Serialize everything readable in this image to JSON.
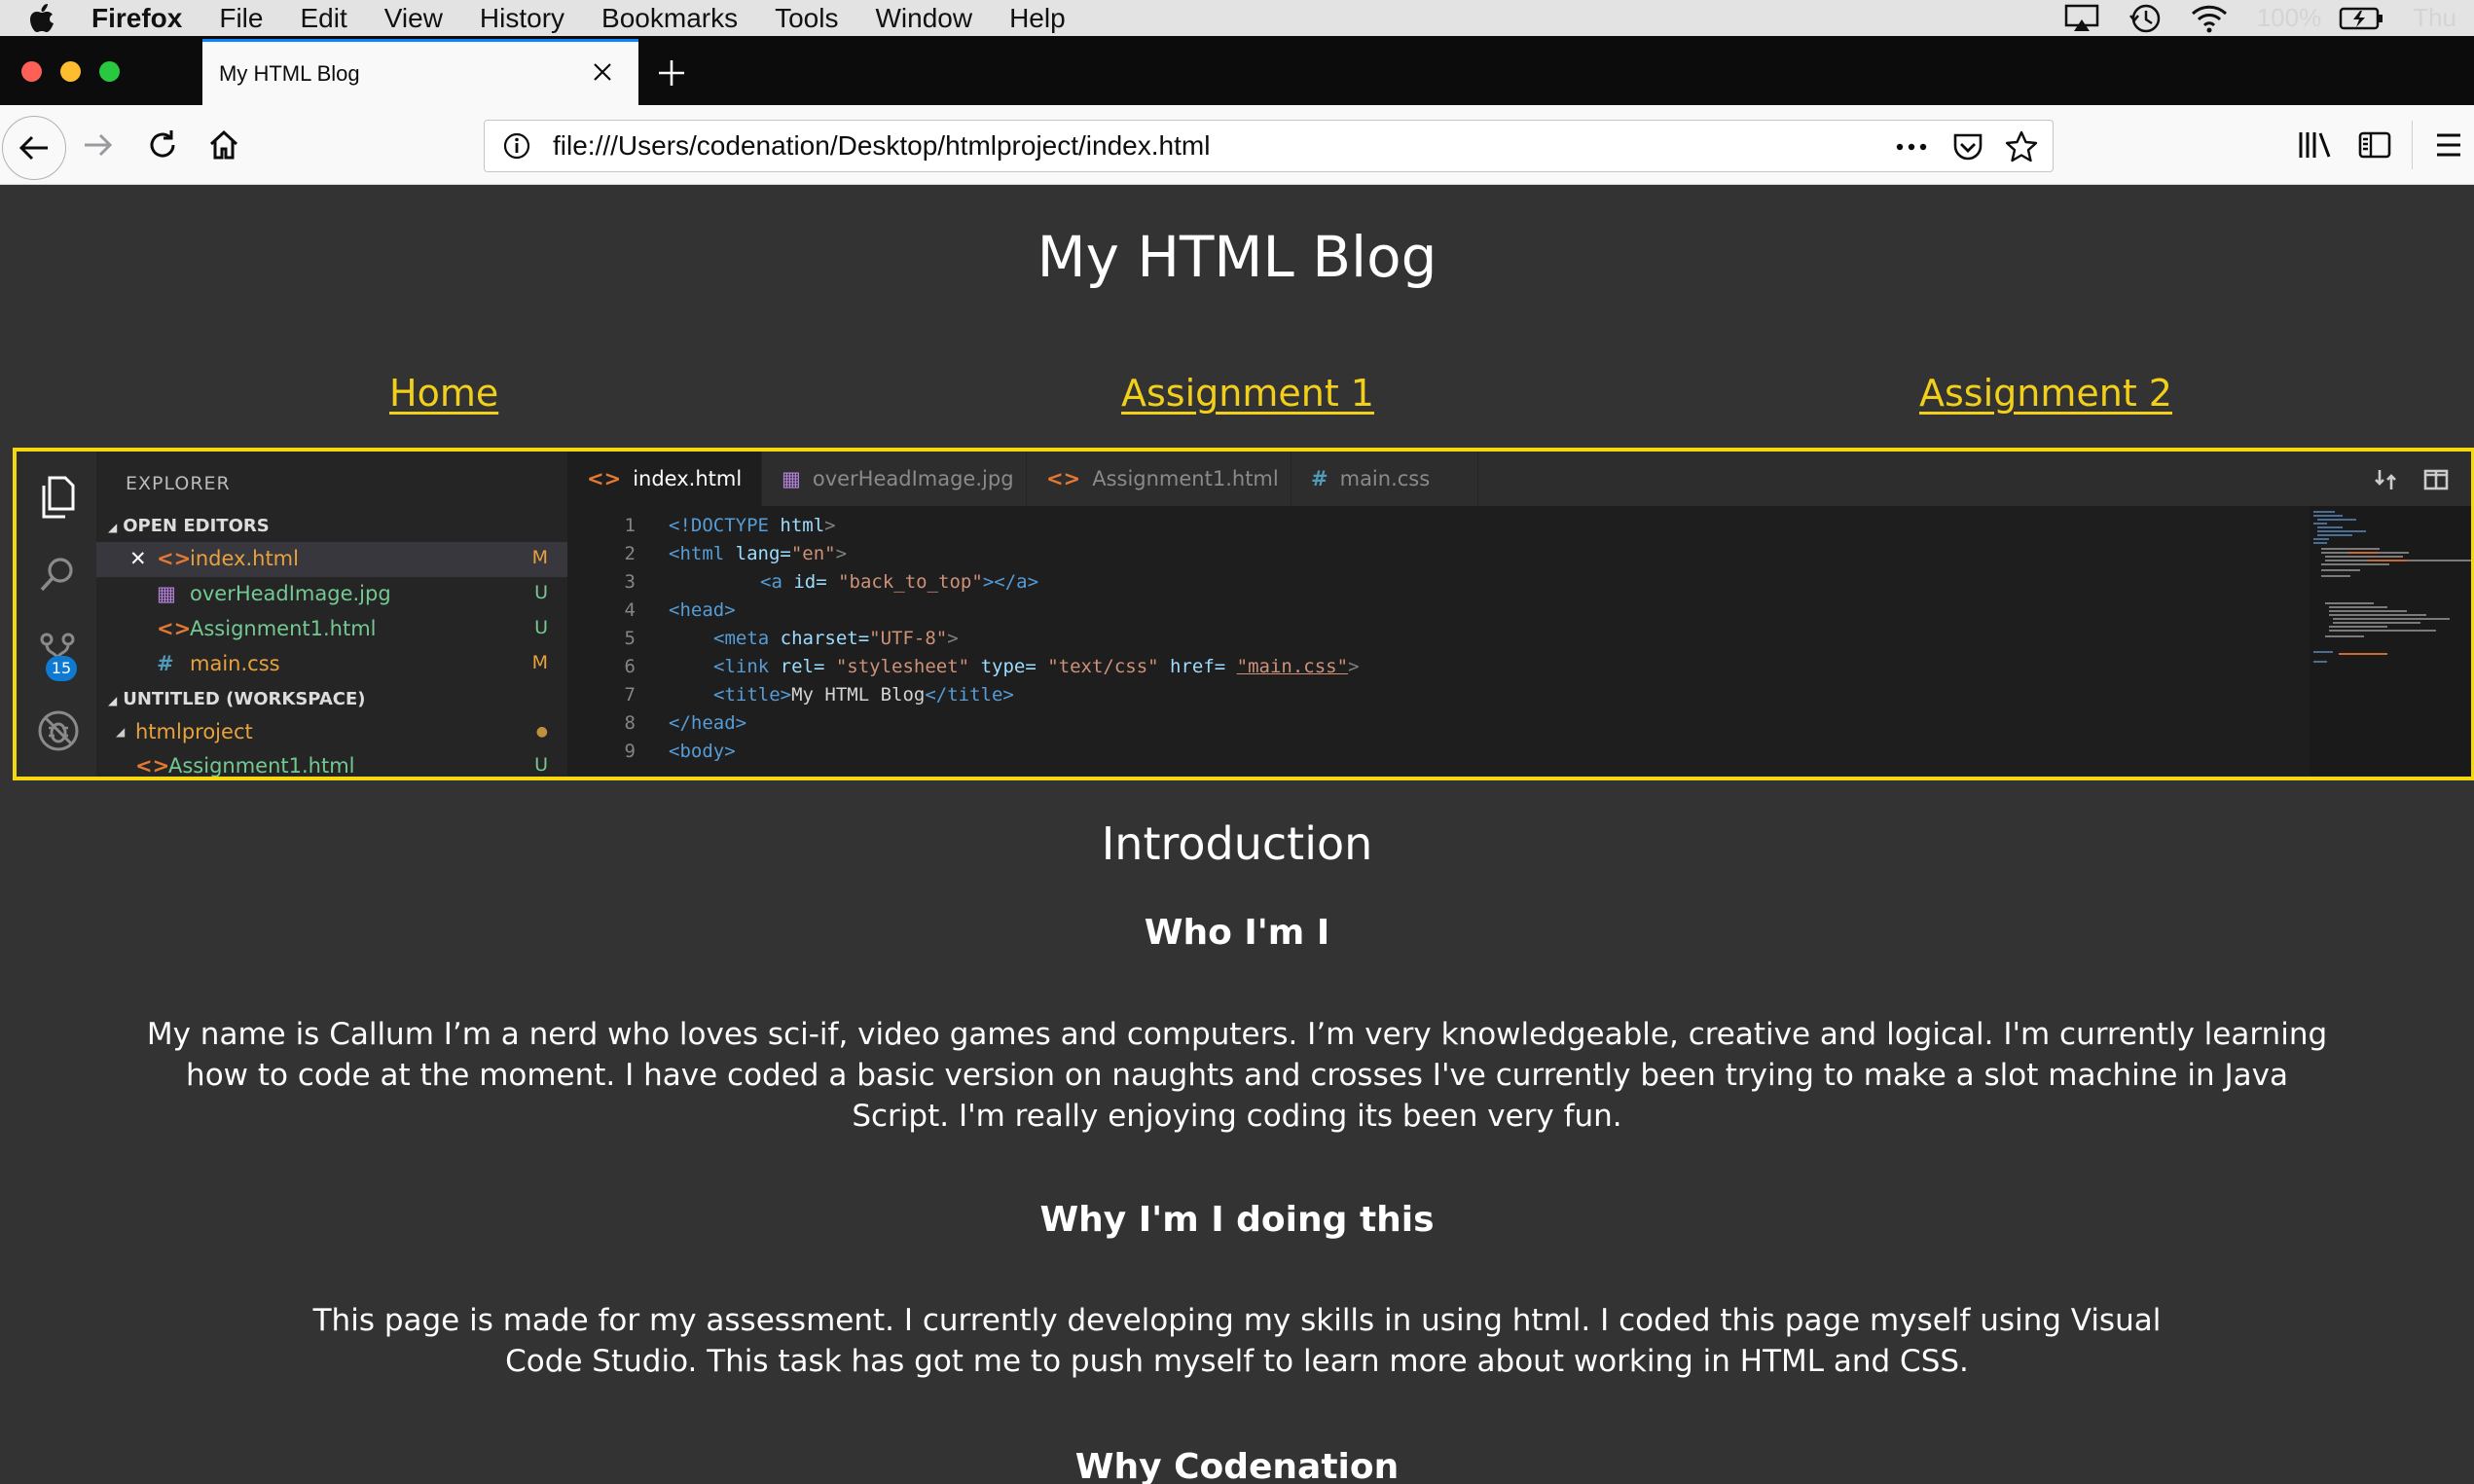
{
  "menubar": {
    "app_name": "Firefox",
    "items": [
      "File",
      "Edit",
      "View",
      "History",
      "Bookmarks",
      "Tools",
      "Window",
      "Help"
    ],
    "battery": "100%",
    "clock": "Thu",
    "icons": [
      "apple-icon",
      "airplay-icon",
      "time-machine-icon",
      "wifi-icon",
      "battery-icon"
    ]
  },
  "browser": {
    "tab_title": "My HTML Blog",
    "url": "file:///Users/codenation/Desktop/htmlproject/index.html",
    "accent": "#0a84ff"
  },
  "page": {
    "title": "My HTML Blog",
    "nav": {
      "home": "Home",
      "assignment1": "Assignment 1",
      "assignment2": "Assignment 2"
    },
    "link_color": "#f2cf1b",
    "background": "#333333",
    "intro_heading": "Introduction",
    "sections": [
      {
        "heading": "Who I'm I",
        "paragraph": "My name is Callum I’m a nerd who loves sci-if, video games and computers. I’m very knowledgeable, creative and logical. I'm currently learning how to code at the moment. I have coded a basic version on naughts and crosses I've currently been trying to make a slot machine in Java Script. I'm really enjoying coding its been very fun."
      },
      {
        "heading": "Why I'm I doing this",
        "paragraph": "This page is made for my assessment. I currently developing my skills in using html. I coded this page myself using Visual Code Studio. This task has got me to push myself to learn more about working in HTML and CSS."
      },
      {
        "heading": "Why Codenation"
      }
    ]
  },
  "screenshot": {
    "border_color": "#f4d80f",
    "explorer": {
      "title": "EXPLORER",
      "open_editors": "OPEN EDITORS",
      "workspace": "UNTITLED (WORKSPACE)",
      "project": "htmlproject",
      "files": [
        {
          "name": "index.html",
          "badge": "M",
          "color": "#e8a23b"
        },
        {
          "name": "overHeadImage.jpg",
          "badge": "U",
          "color": "#73c991"
        },
        {
          "name": "Assignment1.html",
          "badge": "U",
          "color": "#73c991"
        },
        {
          "name": "main.css",
          "badge": "M",
          "color": "#e8a23b"
        }
      ],
      "workspace_file": "Assignment1.html",
      "scm_count": "15"
    },
    "tabs": [
      "index.html",
      "overHeadImage.jpg",
      "Assignment1.html",
      "main.css"
    ],
    "line_numbers": [
      "1",
      "2",
      "3",
      "4",
      "5",
      "6",
      "7",
      "8",
      "9"
    ],
    "code": {
      "l1": [
        "<!DOCTYPE",
        " html",
        ">"
      ],
      "l2": [
        "<html",
        " lang=",
        "\"en\"",
        ">"
      ],
      "l3": [
        "<a",
        " id= ",
        "\"back_to_top\"",
        "></a>"
      ],
      "l4": [
        "<head>"
      ],
      "l5": [
        "<meta",
        " charset=",
        "\"UTF-8\"",
        ">"
      ],
      "l6": [
        "<link",
        " rel= ",
        "\"stylesheet\"",
        " type= ",
        "\"text/css\"",
        " href= ",
        "\"main.css\"",
        ">"
      ],
      "l7": [
        "<title>",
        "My HTML Blog",
        "</title>"
      ],
      "l8": [
        "</head>"
      ],
      "l9": [
        "<body>"
      ]
    }
  }
}
